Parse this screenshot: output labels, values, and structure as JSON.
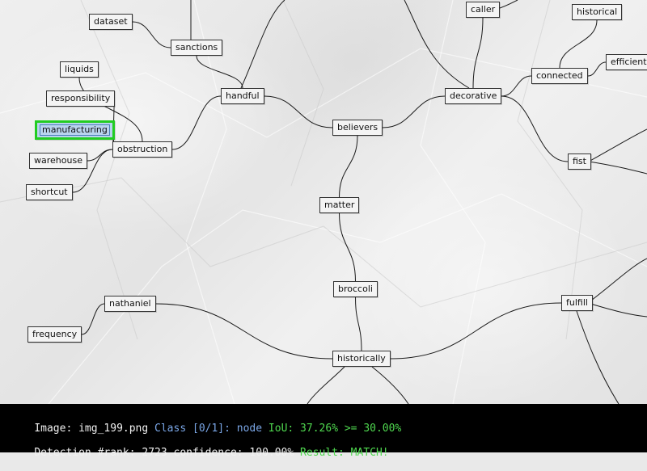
{
  "diagram": {
    "nodes": [
      {
        "id": "dataset",
        "label": "dataset"
      },
      {
        "id": "sanctions",
        "label": "sanctions"
      },
      {
        "id": "liquids",
        "label": "liquids"
      },
      {
        "id": "responsibility",
        "label": "responsibility"
      },
      {
        "id": "manufacturing",
        "label": "manufacturing",
        "highlighted": true
      },
      {
        "id": "warehouse",
        "label": "warehouse"
      },
      {
        "id": "shortcut",
        "label": "shortcut"
      },
      {
        "id": "obstruction",
        "label": "obstruction"
      },
      {
        "id": "handful",
        "label": "handful"
      },
      {
        "id": "believers",
        "label": "believers"
      },
      {
        "id": "matter",
        "label": "matter"
      },
      {
        "id": "broccoli",
        "label": "broccoli"
      },
      {
        "id": "historically",
        "label": "historically"
      },
      {
        "id": "nathaniel",
        "label": "nathaniel"
      },
      {
        "id": "frequency",
        "label": "frequency"
      },
      {
        "id": "fulfill",
        "label": "fulfill"
      },
      {
        "id": "decorative",
        "label": "decorative"
      },
      {
        "id": "caller",
        "label": "caller"
      },
      {
        "id": "historical",
        "label": "historical"
      },
      {
        "id": "connected",
        "label": "connected"
      },
      {
        "id": "efficient",
        "label": "efficient"
      },
      {
        "id": "fist",
        "label": "fist"
      }
    ],
    "edges": [
      [
        "dataset",
        "sanctions"
      ],
      [
        "sanctions",
        "handful"
      ],
      [
        "liquids",
        "obstruction"
      ],
      [
        "responsibility",
        "obstruction"
      ],
      [
        "manufacturing",
        "obstruction"
      ],
      [
        "warehouse",
        "obstruction"
      ],
      [
        "shortcut",
        "obstruction"
      ],
      [
        "obstruction",
        "handful"
      ],
      [
        "handful",
        "believers"
      ],
      [
        "believers",
        "decorative"
      ],
      [
        "believers",
        "matter"
      ],
      [
        "matter",
        "broccoli"
      ],
      [
        "broccoli",
        "historically"
      ],
      [
        "nathaniel",
        "historically"
      ],
      [
        "frequency",
        "nathaniel"
      ],
      [
        "historically",
        "fulfill"
      ],
      [
        "decorative",
        "caller"
      ],
      [
        "decorative",
        "connected"
      ],
      [
        "connected",
        "historical"
      ],
      [
        "connected",
        "efficient"
      ],
      [
        "decorative",
        "fist"
      ]
    ]
  },
  "hud": {
    "image_label": "Image: ",
    "image_name": "img_199.png",
    "class_text": "Class [0/1]:",
    "class_name": "node",
    "iou_text": "IoU: 37.26% >= 30.00%",
    "detection_text": "Detection #rank: 2723 confidence: 100.00%",
    "result_text": "Result: MATCH!"
  },
  "colors": {
    "highlight_border": "#22cc22",
    "highlight_fill": "#b9d4ee",
    "hud_background": "#000000",
    "hud_blue": "#7aa6e6",
    "hud_green": "#4fd84f"
  }
}
